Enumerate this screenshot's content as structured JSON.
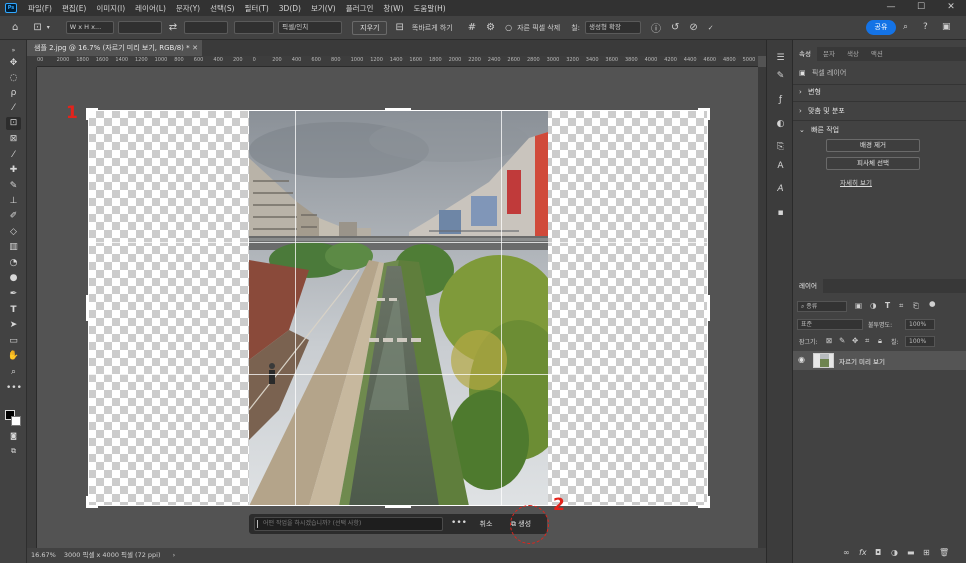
{
  "app": {
    "logo": "Ps"
  },
  "menu": [
    "파일(F)",
    "편집(E)",
    "이미지(I)",
    "레이어(L)",
    "문자(Y)",
    "선택(S)",
    "필터(T)",
    "3D(D)",
    "보기(V)",
    "플러그인",
    "창(W)",
    "도움말(H)"
  ],
  "window_controls": {
    "minimize": "—",
    "maximize": "☐",
    "close": "✕"
  },
  "options": {
    "ratio_select": "W x H x...",
    "unit_select": "픽셀/인치",
    "clear_label": "지우기",
    "straighten_label": "똑바르게 하기",
    "delete_cropped_label": "자른 픽셀 삭제",
    "fill_label": "칠:",
    "fill_select": "생성형 확장",
    "share_label": "공유"
  },
  "document": {
    "tab_title": "샘플 2.jpg @ 16.7% (자르기 미리 보기, RGB/8) *",
    "close": "✕"
  },
  "ruler_labels": [
    "00",
    "2000",
    "1800",
    "1600",
    "1400",
    "1200",
    "1000",
    "800",
    "600",
    "400",
    "200",
    "0",
    "200",
    "400",
    "600",
    "800",
    "1000",
    "1200",
    "1400",
    "1600",
    "1800",
    "2000",
    "2200",
    "2400",
    "2600",
    "2800",
    "3000",
    "3200",
    "3400",
    "3600",
    "3800",
    "4000",
    "4200",
    "4400",
    "4600",
    "4800",
    "5000"
  ],
  "markers": {
    "one": "1",
    "two": "2"
  },
  "taskbar": {
    "prompt_placeholder": "어떤 작업을 하시겠습니까? (선택 사항)",
    "more_label": "•••",
    "cancel_label": "취소",
    "generate_label": "생성"
  },
  "status": {
    "zoom": "16.67%",
    "doc_info": "3000 픽셀 x 4000 픽셀 (72 ppi)",
    "arrow": "›"
  },
  "properties": {
    "tabs": [
      "속성",
      "문자",
      "색상",
      "액션"
    ],
    "layer_type": "픽셀 레이어",
    "section_transform": "변형",
    "section_align": "맞춤 및 분포",
    "section_quick": "빠른 작업",
    "remove_bg_label": "배경 제거",
    "select_subject_label": "피사체 선택",
    "see_more_label": "자세히 보기"
  },
  "layers": {
    "tab": "레이어",
    "filter_label": "종류",
    "blend_mode": "표준",
    "opacity_label": "불투명도:",
    "opacity_value": "100%",
    "lock_label": "잠그기:",
    "fill_label": "칠:",
    "fill_value": "100%",
    "layer_name": "자르기 미리 보기"
  }
}
